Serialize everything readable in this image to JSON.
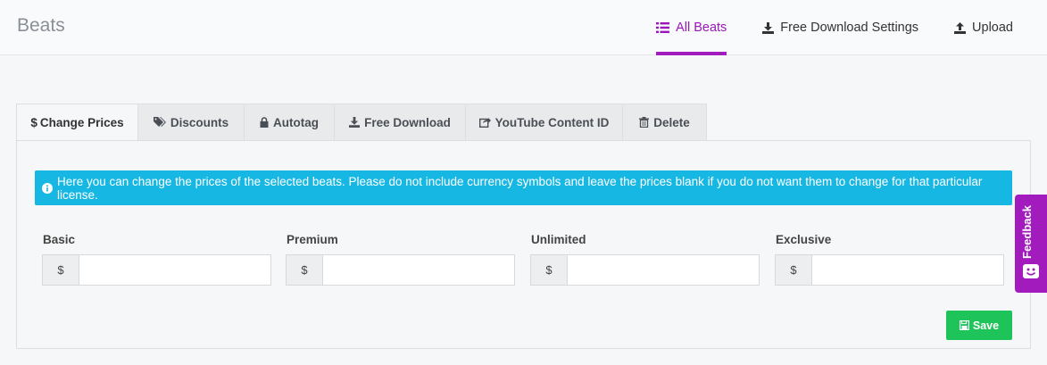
{
  "header": {
    "brand": "Beats",
    "nav": [
      {
        "label": "All Beats",
        "icon": "list-icon",
        "active": true
      },
      {
        "label": "Free Download Settings",
        "icon": "download-icon"
      },
      {
        "label": "Upload",
        "icon": "upload-icon"
      }
    ]
  },
  "tabs": [
    {
      "label": "Change Prices",
      "icon": "dollar-icon",
      "active": true
    },
    {
      "label": "Discounts",
      "icon": "tags-icon"
    },
    {
      "label": "Autotag",
      "icon": "lock-icon"
    },
    {
      "label": "Free Download",
      "icon": "download-icon"
    },
    {
      "label": "YouTube Content ID",
      "icon": "share-icon"
    },
    {
      "label": "Delete",
      "icon": "trash-icon"
    }
  ],
  "alert": {
    "text": "Here you can change the prices of the selected beats. Please do not include currency symbols and leave the prices blank if you do not want them to change for that particular license."
  },
  "prices": [
    {
      "label": "Basic",
      "currency": "$",
      "value": "",
      "placeholder": ""
    },
    {
      "label": "Premium",
      "currency": "$",
      "value": "",
      "placeholder": ""
    },
    {
      "label": "Unlimited",
      "currency": "$",
      "value": "",
      "placeholder": ""
    },
    {
      "label": "Exclusive",
      "currency": "$",
      "value": "",
      "placeholder": ""
    }
  ],
  "save_label": "Save",
  "feedback_label": "Feedback",
  "colors": {
    "accent": "#a21bbd",
    "info": "#16b7e3",
    "success": "#1ec35a"
  }
}
